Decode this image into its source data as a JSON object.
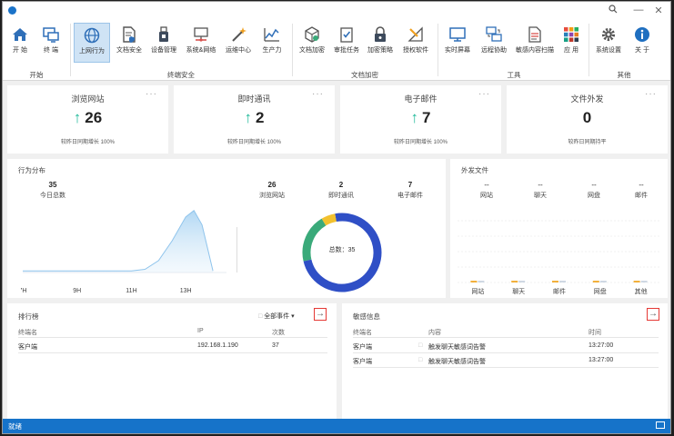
{
  "titlebar": {
    "search_icon": "search-icon",
    "minimize": "—",
    "close": "✕"
  },
  "ribbon": {
    "groups": [
      {
        "label": "开始"
      },
      {
        "label": "终端安全"
      },
      {
        "label": "文档加密"
      },
      {
        "label": "工具"
      },
      {
        "label": "其他"
      }
    ],
    "items": [
      {
        "label": "开 始",
        "icon": "home-icon"
      },
      {
        "label": "终 端",
        "icon": "terminal-icon"
      },
      {
        "label": "上网行为",
        "icon": "globe-icon"
      },
      {
        "label": "文档安全",
        "icon": "document-shield-icon"
      },
      {
        "label": "设备管理",
        "icon": "usb-icon"
      },
      {
        "label": "系统&网络",
        "icon": "network-icon"
      },
      {
        "label": "运维中心",
        "icon": "wand-icon"
      },
      {
        "label": "生产力",
        "icon": "chart-icon"
      },
      {
        "label": "文档加密",
        "icon": "encrypt-box-icon"
      },
      {
        "label": "审批任务",
        "icon": "checklist-icon"
      },
      {
        "label": "加密策略",
        "icon": "lock-icon"
      },
      {
        "label": "授权软件",
        "icon": "ruler-icon"
      },
      {
        "label": "实时屏幕",
        "icon": "monitor-icon"
      },
      {
        "label": "远程协助",
        "icon": "remote-icon"
      },
      {
        "label": "敏感内容扫描",
        "icon": "scan-doc-icon"
      },
      {
        "label": "应 用",
        "icon": "apps-grid-icon"
      },
      {
        "label": "系统设置",
        "icon": "gear-icon"
      },
      {
        "label": "关 于",
        "icon": "info-icon"
      }
    ]
  },
  "cards": [
    {
      "title": "浏览网站",
      "value": "26",
      "trend": "up",
      "footer": "较昨日同期增长 100%"
    },
    {
      "title": "即时通讯",
      "value": "2",
      "trend": "up",
      "footer": "较昨日同期增长 100%"
    },
    {
      "title": "电子邮件",
      "value": "7",
      "trend": "up",
      "footer": "较昨日同期增长 100%"
    },
    {
      "title": "文件外发",
      "value": "0",
      "trend": "none",
      "footer": "较昨日同期持平"
    }
  ],
  "behavior": {
    "title": "行为分布",
    "total_value": "35",
    "total_label": "今日总数",
    "stats": [
      {
        "value": "26",
        "label": "浏览网站"
      },
      {
        "value": "2",
        "label": "即时通讯"
      },
      {
        "value": "7",
        "label": "电子邮件"
      }
    ],
    "donut_label": "总数：35",
    "colors": {
      "web": "#2f4fc6",
      "im": "#f2c12e",
      "mail": "#3aaa7a"
    }
  },
  "chart_data": {
    "type": "area",
    "x_ticks": [
      "7H",
      "9H",
      "11H",
      "13H"
    ],
    "x": [
      7,
      8,
      9,
      10,
      11,
      11.5,
      12,
      12.5,
      13,
      13.3,
      13.6,
      14
    ],
    "y": [
      2,
      2,
      2,
      2,
      2,
      4,
      15,
      40,
      70,
      78,
      60,
      2
    ]
  },
  "outgoing": {
    "title": "外发文件",
    "columns": [
      {
        "value": "--",
        "label": "网站"
      },
      {
        "value": "--",
        "label": "聊天"
      },
      {
        "value": "--",
        "label": "网盘"
      },
      {
        "value": "--",
        "label": "邮件"
      }
    ],
    "bar_labels": [
      "网站",
      "聊天",
      "邮件",
      "网盘",
      "其他"
    ]
  },
  "ranking": {
    "title": "排行榜",
    "filter": "全部事件",
    "headers": [
      "终端名",
      "IP",
      "次数"
    ],
    "rows": [
      {
        "name": "客户端",
        "ip": "192.168.1.190",
        "count": "37"
      }
    ]
  },
  "sensitive": {
    "title": "敏感信息",
    "headers": [
      "终端名",
      "内容",
      "时间"
    ],
    "rows": [
      {
        "name": "客户端",
        "content": "触发聊天敏感词告警",
        "time": "13:27:00"
      },
      {
        "name": "客户端",
        "content": "触发聊天敏感词告警",
        "time": "13:27:00"
      }
    ]
  },
  "status": {
    "text": "就绪"
  }
}
